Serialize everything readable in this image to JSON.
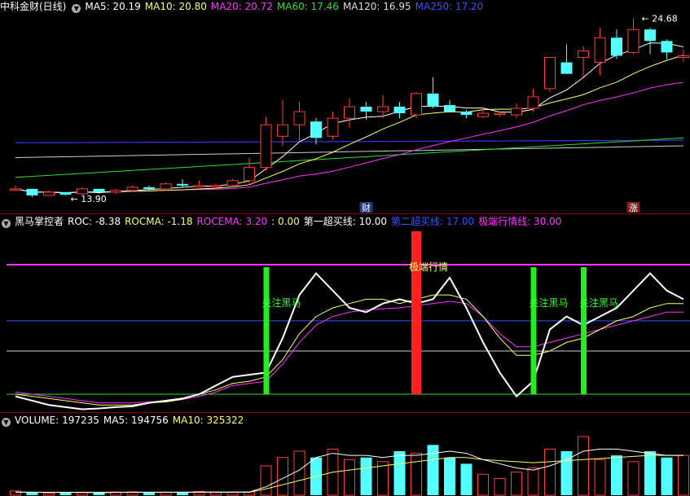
{
  "colors": {
    "up": "#ff3b3b",
    "down": "#54ffff",
    "ma5": "#ffffff",
    "ma10": "#ffff66",
    "ma20": "#ff33ff",
    "ma60": "#33dd33",
    "ma120": "#cccccc",
    "ma250": "#3333ff"
  },
  "main_panel": {
    "title": "中科金财(日线)",
    "indicators": [
      {
        "label": "MA5: 20.19",
        "color": "#ffffff"
      },
      {
        "label": "MA10: 20.80",
        "color": "#ffff66"
      },
      {
        "label": "MA20: 20.72",
        "color": "#ff33ff"
      },
      {
        "label": "MA60: 17.46",
        "color": "#33dd33"
      },
      {
        "label": "MA120: 16.95",
        "color": "#dddddd"
      },
      {
        "label": "MA250: 17.20",
        "color": "#3355ff"
      }
    ],
    "high_label": "24.68",
    "low_label": "13.90",
    "marker_cai": "财",
    "marker_zhang": "涨"
  },
  "indicator_panel": {
    "title": "黑马掌控者",
    "legend": [
      {
        "label": "ROC: -8.38",
        "color": "#ffffff"
      },
      {
        "label": "ROCMA: -1.18",
        "color": "#ffff66"
      },
      {
        "label": "ROCEMA: 3.20",
        "color": "#ff33ff"
      },
      {
        "label": ": 0.00",
        "color": "#ffff66"
      },
      {
        "label": "第一超买线: 10.00",
        "color": "#ffffff"
      },
      {
        "label": "第二超买线: 17.00",
        "color": "#3355ff"
      },
      {
        "label": "极端行情线: 30.00",
        "color": "#ff33ff"
      }
    ],
    "signal_label_green": "关注黑马",
    "signal_label_red": "极端行情"
  },
  "volume_panel": {
    "legend": [
      {
        "label": "VOLUME: 197235",
        "color": "#ffffff"
      },
      {
        "label": "MA5: 194756",
        "color": "#ffffff"
      },
      {
        "label": "MA10: 325322",
        "color": "#ffff66"
      }
    ]
  },
  "chart_data": [
    {
      "type": "candlestick",
      "title": "中科金财(日线)",
      "y_annotations": {
        "high": 24.68,
        "low": 13.9
      },
      "ohlc": [
        [
          14.3,
          14.5,
          14.2,
          14.3
        ],
        [
          14.3,
          14.3,
          13.8,
          13.9
        ],
        [
          13.9,
          14.2,
          13.9,
          14.1
        ],
        [
          14.1,
          14.1,
          13.9,
          13.95
        ],
        [
          14.0,
          14.4,
          13.9,
          14.3
        ],
        [
          14.3,
          14.3,
          14.0,
          14.1
        ],
        [
          14.1,
          14.3,
          14.0,
          14.2
        ],
        [
          14.2,
          14.5,
          14.1,
          14.4
        ],
        [
          14.4,
          14.5,
          14.2,
          14.3
        ],
        [
          14.3,
          14.7,
          14.2,
          14.6
        ],
        [
          14.6,
          14.9,
          14.4,
          14.5
        ],
        [
          14.5,
          14.8,
          14.4,
          14.5
        ],
        [
          14.5,
          14.6,
          14.3,
          14.5
        ],
        [
          14.5,
          14.9,
          14.4,
          14.8
        ],
        [
          14.8,
          16.2,
          14.6,
          15.6
        ],
        [
          15.6,
          18.7,
          15.4,
          18.2
        ],
        [
          17.5,
          19.7,
          16.9,
          18.2
        ],
        [
          18.2,
          19.6,
          17.2,
          19.0
        ],
        [
          18.4,
          18.6,
          17.0,
          17.4
        ],
        [
          17.5,
          19.0,
          17.3,
          18.6
        ],
        [
          18.6,
          19.8,
          18.0,
          19.3
        ],
        [
          19.3,
          19.6,
          18.5,
          19.0
        ],
        [
          19.0,
          20.0,
          18.6,
          19.3
        ],
        [
          19.3,
          19.6,
          18.6,
          18.9
        ],
        [
          18.8,
          20.2,
          18.6,
          20.1
        ],
        [
          20.1,
          21.1,
          19.2,
          19.3
        ],
        [
          19.4,
          19.7,
          19.0,
          19.0
        ],
        [
          19.0,
          19.1,
          18.6,
          18.8
        ],
        [
          18.7,
          19.2,
          18.6,
          18.9
        ],
        [
          18.9,
          19.0,
          18.7,
          18.9
        ],
        [
          18.8,
          19.5,
          18.6,
          19.2
        ],
        [
          19.2,
          20.4,
          19.0,
          19.9
        ],
        [
          20.4,
          22.3,
          20.2,
          22.3
        ],
        [
          22.0,
          23.1,
          21.4,
          21.3
        ],
        [
          22.3,
          23.0,
          21.1,
          22.7
        ],
        [
          22.0,
          24.1,
          21.2,
          23.5
        ],
        [
          23.5,
          24.0,
          22.2,
          22.4
        ],
        [
          22.6,
          24.68,
          22.5,
          24.0
        ],
        [
          24.0,
          24.1,
          22.5,
          23.3
        ],
        [
          23.3,
          23.4,
          22.2,
          22.6
        ],
        [
          22.3,
          22.8,
          22.0,
          22.4
        ]
      ]
    },
    {
      "type": "line",
      "title": "黑马掌控者",
      "hlines": {
        "first_overbought": 10.0,
        "second_overbought": 17.0,
        "extreme": 30.0,
        "zero": 0.0
      },
      "series": [
        {
          "name": "ROC",
          "values": [
            -0.5,
            -1.5,
            -2.5,
            -3,
            -3.5,
            -3.3,
            -3,
            -2.8,
            -2,
            -1.5,
            -1,
            0,
            2,
            4,
            4.5,
            5,
            13,
            23,
            28,
            24,
            20,
            19,
            21,
            22,
            21,
            22,
            27,
            20,
            12,
            5,
            -0.5,
            3,
            15,
            18,
            16,
            18,
            20,
            24,
            28,
            24,
            22
          ]
        },
        {
          "name": "ROCMA",
          "values": [
            0,
            -0.5,
            -1,
            -1.5,
            -2,
            -2.5,
            -2.5,
            -2.5,
            -2,
            -1.8,
            -1.2,
            0,
            1,
            2.5,
            3,
            4,
            8,
            14,
            18,
            20,
            21,
            22,
            22,
            21,
            22,
            23,
            23,
            22,
            18,
            13,
            9,
            9,
            10,
            12,
            13,
            15,
            17,
            18,
            20,
            21,
            21
          ]
        },
        {
          "name": "ROCEMA",
          "values": [
            0.5,
            0,
            -0.5,
            -1,
            -1.5,
            -2,
            -2,
            -2,
            -1.8,
            -1.6,
            -1.2,
            -0.5,
            0.5,
            2,
            2.5,
            3,
            7,
            12,
            16,
            18,
            19,
            19.5,
            19.8,
            20,
            20.5,
            21,
            21.5,
            21,
            18,
            14,
            11,
            11,
            12,
            13,
            14,
            15,
            16,
            17,
            18,
            19,
            19
          ]
        }
      ],
      "signals": [
        {
          "bar": 15,
          "type": "关注黑马"
        },
        {
          "bar": 24,
          "type": "极端行情"
        },
        {
          "bar": 31,
          "type": "关注黑马"
        },
        {
          "bar": 34,
          "type": "关注黑马"
        }
      ]
    },
    {
      "type": "bar",
      "title": "VOLUME",
      "volume": [
        20,
        15,
        10,
        12,
        12,
        14,
        15,
        16,
        12,
        14,
        16,
        18,
        14,
        15,
        16,
        140,
        180,
        210,
        180,
        220,
        170,
        180,
        160,
        210,
        200,
        240,
        180,
        150,
        100,
        80,
        110,
        130,
        220,
        210,
        280,
        170,
        190,
        160,
        210,
        180,
        190
      ],
      "ma5": [
        15,
        14,
        13,
        13,
        13,
        12,
        13,
        14,
        14,
        14,
        14,
        15,
        15,
        15,
        15,
        40,
        80,
        120,
        180,
        200,
        190,
        190,
        180,
        190,
        190,
        200,
        210,
        200,
        170,
        150,
        130,
        120,
        140,
        170,
        210,
        220,
        220,
        210,
        200,
        190,
        190
      ],
      "ma10": [
        14,
        14,
        14,
        14,
        14,
        14,
        14,
        14,
        14,
        14,
        14,
        14,
        14,
        14,
        14,
        30,
        50,
        70,
        90,
        110,
        120,
        130,
        140,
        150,
        160,
        170,
        180,
        180,
        170,
        165,
        160,
        155,
        160,
        165,
        170,
        175,
        180,
        185,
        190,
        190,
        190
      ]
    }
  ]
}
